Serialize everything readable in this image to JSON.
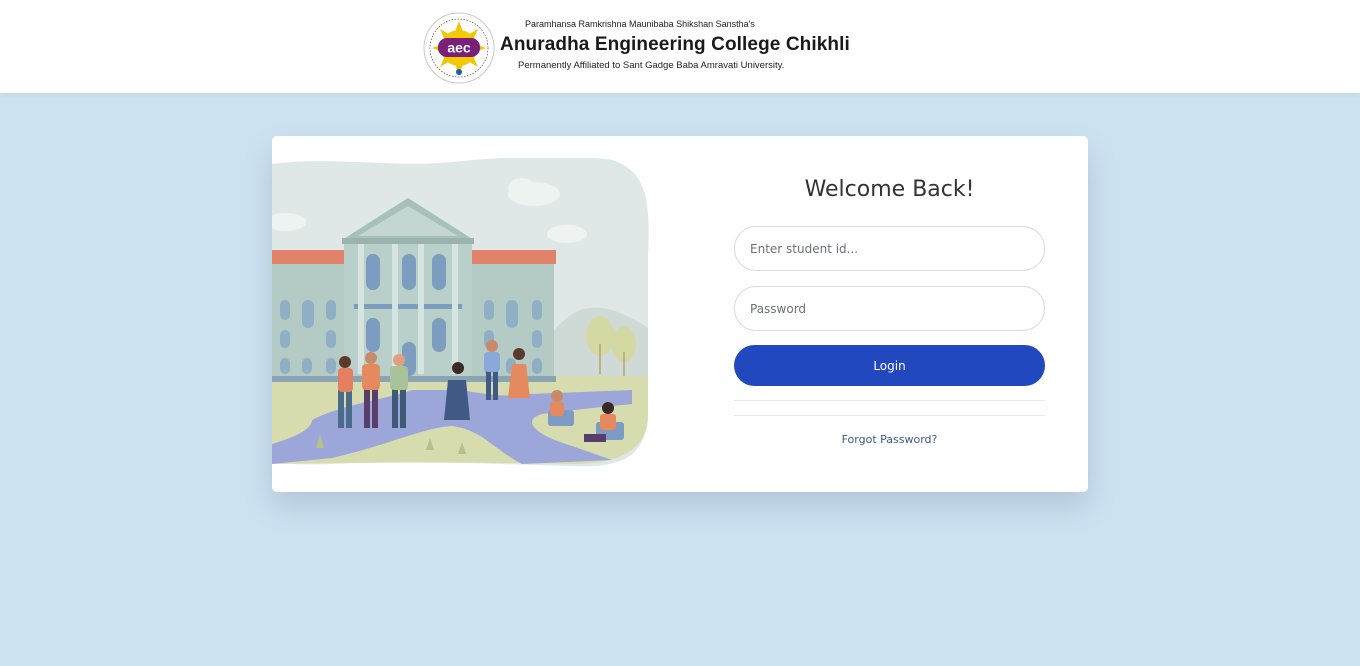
{
  "header": {
    "trust_name": "Paramhansa Ramkrishna Maunibaba Shikshan Sanstha's",
    "college_name": "Anuradha Engineering College Chikhli",
    "affiliation": "Permanently Affiliated to Sant Gadge Baba Amravati University.",
    "logo": {
      "initials": "aec",
      "icon": "college-seal-icon"
    }
  },
  "login": {
    "title": "Welcome Back!",
    "student_id_placeholder": "Enter student id...",
    "student_id_value": "",
    "password_placeholder": "Password",
    "password_value": "",
    "login_label": "Login",
    "forgot_label": "Forgot Password?"
  },
  "colors": {
    "page_bg": "#cde2f1",
    "primary_button": "#2148bf",
    "link": "#3a5a8c"
  }
}
